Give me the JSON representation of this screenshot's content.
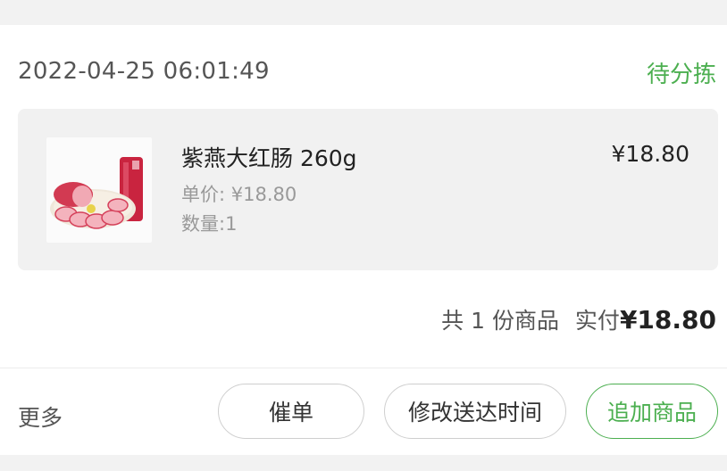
{
  "order": {
    "time": "2022-04-25 06:01:49",
    "status": "待分拣",
    "status_color": "#4caf50"
  },
  "item": {
    "image_icon": "product-photo-red-sausage",
    "name": "紫燕大红肠 260g",
    "price": "¥18.80",
    "unit_price": "单价: ¥18.80",
    "quantity": "数量:1"
  },
  "summary": {
    "count_text": "共 1 份商品",
    "paid_label": "实付",
    "paid_amount": "¥18.80"
  },
  "actions": {
    "more": "更多",
    "urge": "催单",
    "change_time": "修改送达时间",
    "add_items": "追加商品"
  }
}
